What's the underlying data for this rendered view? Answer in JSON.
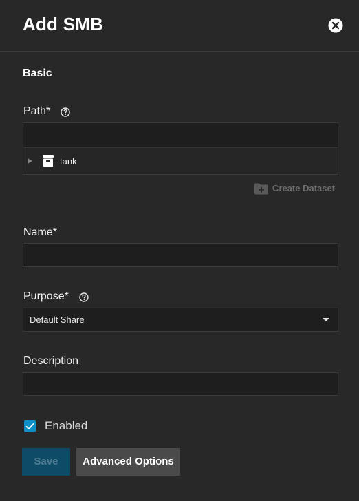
{
  "header": {
    "title": "Add SMB"
  },
  "form": {
    "section_title": "Basic",
    "path": {
      "label": "Path",
      "required_mark": "*",
      "value": "",
      "tree_items": [
        {
          "label": "tank",
          "icon": "dataset-icon",
          "expanded": false
        }
      ],
      "create_dataset_label": "Create Dataset"
    },
    "name": {
      "label": "Name",
      "required_mark": "*",
      "value": ""
    },
    "purpose": {
      "label": "Purpose",
      "required_mark": "*",
      "selected": "Default Share"
    },
    "description": {
      "label": "Description",
      "value": ""
    },
    "enabled": {
      "label": "Enabled",
      "checked": true
    }
  },
  "buttons": {
    "save_label": "Save",
    "advanced_label": "Advanced Options"
  },
  "colors": {
    "background": "#282828",
    "accent": "#0d8fc7",
    "save_disabled_bg": "#0e4b66"
  }
}
